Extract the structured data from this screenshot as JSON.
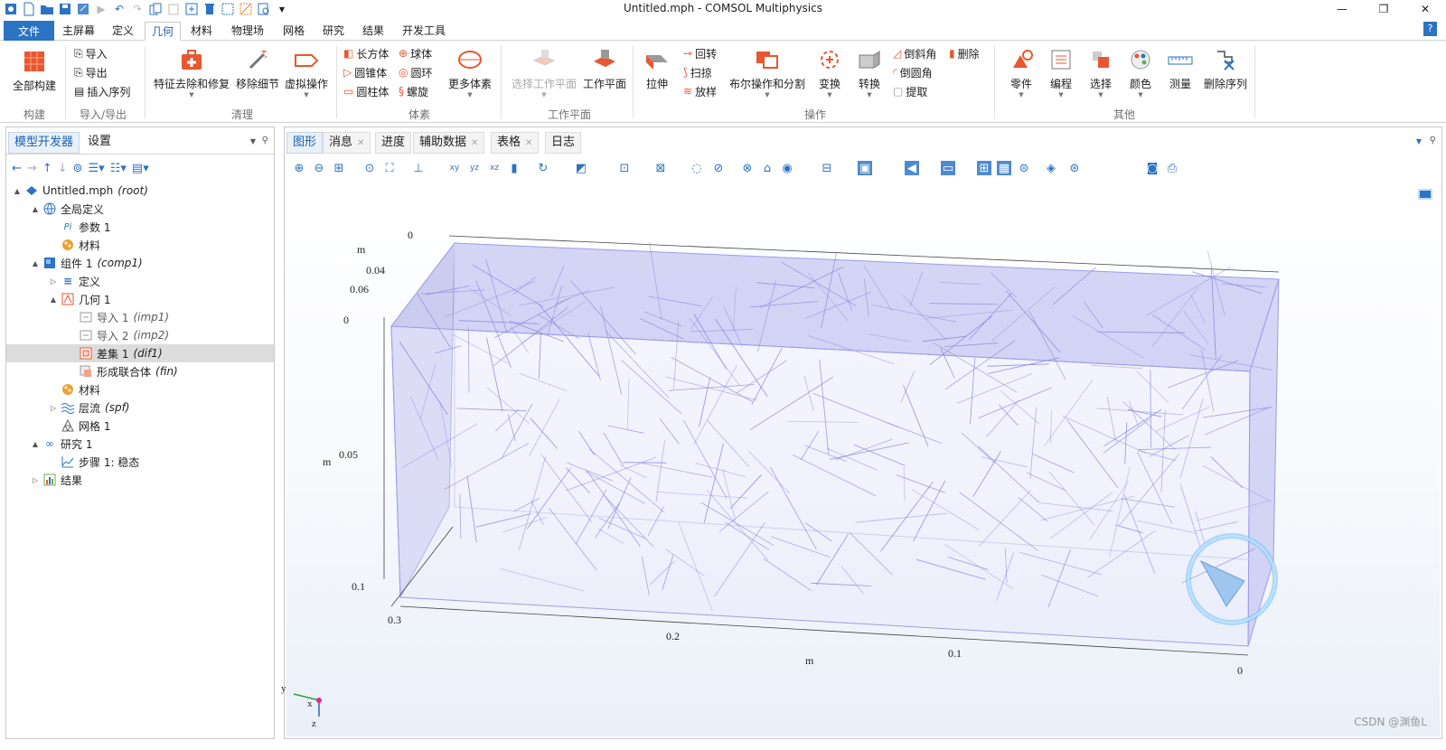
{
  "window": {
    "title": "Untitled.mph - COMSOL Multiphysics"
  },
  "menu": {
    "file": "文件",
    "tabs": [
      "主屏幕",
      "定义",
      "几何",
      "材料",
      "物理场",
      "网格",
      "研究",
      "结果",
      "开发工具"
    ],
    "active": "几何",
    "help": "?"
  },
  "ribbon": {
    "build_all": "全部构建",
    "import": "导入",
    "export": "导出",
    "insert_sequence": "插入序列",
    "defeature": "特征去除和修复",
    "remove_details": "移除细节",
    "virtual_ops": "虚拟操作",
    "block": "长方体",
    "sphere": "球体",
    "cone": "圆锥体",
    "torus": "圆环",
    "cylinder": "圆柱体",
    "helix": "螺旋",
    "more_primitives": "更多体素",
    "select_workplane": "选择工作平面",
    "workplane": "工作平面",
    "extrude": "拉伸",
    "revolve": "回转",
    "sweep": "扫掠",
    "loft": "放样",
    "booleans": "布尔操作和分割",
    "transforms": "变换",
    "conversions": "转换",
    "chamfer": "倒斜角",
    "fillet": "倒圆角",
    "extract": "提取",
    "delete": "删除",
    "parts": "零件",
    "programming": "编程",
    "selections": "选择",
    "colors": "颜色",
    "measure": "测量",
    "delete_sequence": "删除序列",
    "groups": {
      "build": "构建",
      "import_export": "导入/导出",
      "cleanup": "清理",
      "primitives": "体素",
      "workplane": "工作平面",
      "operations": "操作",
      "other": "其他"
    }
  },
  "left_panel": {
    "tabs": [
      "模型开发器",
      "设置"
    ],
    "active_tab": "模型开发器",
    "tree": [
      {
        "label": "Untitled.mph",
        "tag": "(root)",
        "level": 0,
        "icon": "model-icon",
        "toggle": "▲"
      },
      {
        "label": "全局定义",
        "tag": "",
        "level": 1,
        "icon": "globe-icon",
        "toggle": "▲"
      },
      {
        "label": "参数 1",
        "tag": "",
        "level": 2,
        "icon": "parameters-icon",
        "toggle": ""
      },
      {
        "label": "材料",
        "tag": "",
        "level": 2,
        "icon": "materials-icon",
        "toggle": ""
      },
      {
        "label": "组件 1",
        "tag": "(comp1)",
        "level": 1,
        "icon": "component-icon",
        "toggle": "▲"
      },
      {
        "label": "定义",
        "tag": "",
        "level": 2,
        "icon": "definitions-icon",
        "toggle": "▷"
      },
      {
        "label": "几何 1",
        "tag": "",
        "level": 2,
        "icon": "geometry-icon",
        "toggle": "▲"
      },
      {
        "label": "导入 1",
        "tag": "(imp1)",
        "level": 3,
        "icon": "import-icon",
        "toggle": "",
        "dim": true
      },
      {
        "label": "导入 2",
        "tag": "(imp2)",
        "level": 3,
        "icon": "import-icon",
        "toggle": "",
        "dim": true
      },
      {
        "label": "差集 1",
        "tag": "(dif1)",
        "level": 3,
        "icon": "difference-icon",
        "toggle": "",
        "selected": true
      },
      {
        "label": "形成联合体",
        "tag": "(fin)",
        "level": 3,
        "icon": "form-union-icon",
        "toggle": ""
      },
      {
        "label": "材料",
        "tag": "",
        "level": 2,
        "icon": "materials-icon",
        "toggle": ""
      },
      {
        "label": "层流",
        "tag": "(spf)",
        "level": 2,
        "icon": "laminar-flow-icon",
        "toggle": "▷"
      },
      {
        "label": "网格 1",
        "tag": "",
        "level": 2,
        "icon": "mesh-icon",
        "toggle": ""
      },
      {
        "label": "研究 1",
        "tag": "",
        "level": 1,
        "icon": "study-icon",
        "toggle": "▲"
      },
      {
        "label": "步骤 1: 稳态",
        "tag": "",
        "level": 2,
        "icon": "step-icon",
        "toggle": ""
      },
      {
        "label": "结果",
        "tag": "",
        "level": 1,
        "icon": "results-icon",
        "toggle": "▷"
      }
    ]
  },
  "main_panel": {
    "tabs": [
      {
        "label": "图形",
        "closable": false,
        "active": true
      },
      {
        "label": "消息",
        "closable": true
      },
      {
        "label": "进度",
        "closable": false
      },
      {
        "label": "辅助数据",
        "closable": true
      },
      {
        "label": "表格",
        "closable": true
      },
      {
        "label": "日志",
        "closable": false
      }
    ]
  },
  "graphics": {
    "axis_labels": {
      "top_zero": "0",
      "top_m": "m",
      "t004": "0.04",
      "t006": "0.06",
      "left_zero": "0",
      "mid_m": "m",
      "mid_005": "0.05",
      "l01": "0.1",
      "l03": "0.3",
      "b02": "0.2",
      "bottom_m": "m",
      "b01": "0.1",
      "b0": "0"
    },
    "triad": {
      "y": "y",
      "x": "x",
      "z": "z"
    },
    "fiber_color": "#8a8ae0",
    "box_color": "#9c9ce6",
    "fiber_count": 260
  },
  "watermark": "CSDN @渊鱼L"
}
